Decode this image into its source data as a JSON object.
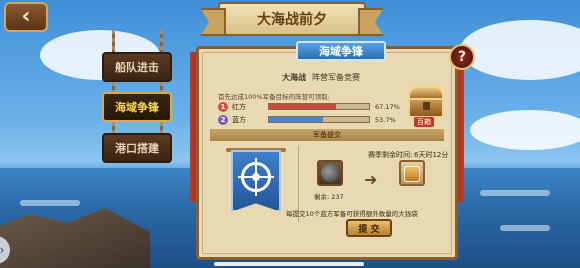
{
  "header": {
    "back_icon": "chevron-left",
    "title": "大海战前夕"
  },
  "side_tabs": [
    {
      "label": "船队进击",
      "active": false
    },
    {
      "label": "海域争锋",
      "active": true
    },
    {
      "label": "港口搭建",
      "active": false
    }
  ],
  "panel": {
    "title": "海域争锋",
    "help_label": "?",
    "event_name": "大海战",
    "event_subtitle": "阵营军备竞赛",
    "condition": "首先达成100%军备目标的阵营可领取:",
    "teams": [
      {
        "number": "1",
        "name": "红方",
        "progress": 0.6717,
        "percent": "67.17%",
        "color": "#d94a3a"
      },
      {
        "number": "2",
        "name": "蓝方",
        "progress": 0.537,
        "percent": "53.7%",
        "color": "#3a86d6"
      }
    ],
    "reward_chest_label": "百箱",
    "section_title": "军备提交",
    "countdown_label": "赛季剩余时间:",
    "countdown_value": "6天时12分",
    "remaining_label": "剩余: 237",
    "submit_desc": "每提交10个蓝方军备可获得额外数量的大钱袋",
    "submit_button": "提 交"
  },
  "nav": {
    "left_arrow": "›"
  }
}
